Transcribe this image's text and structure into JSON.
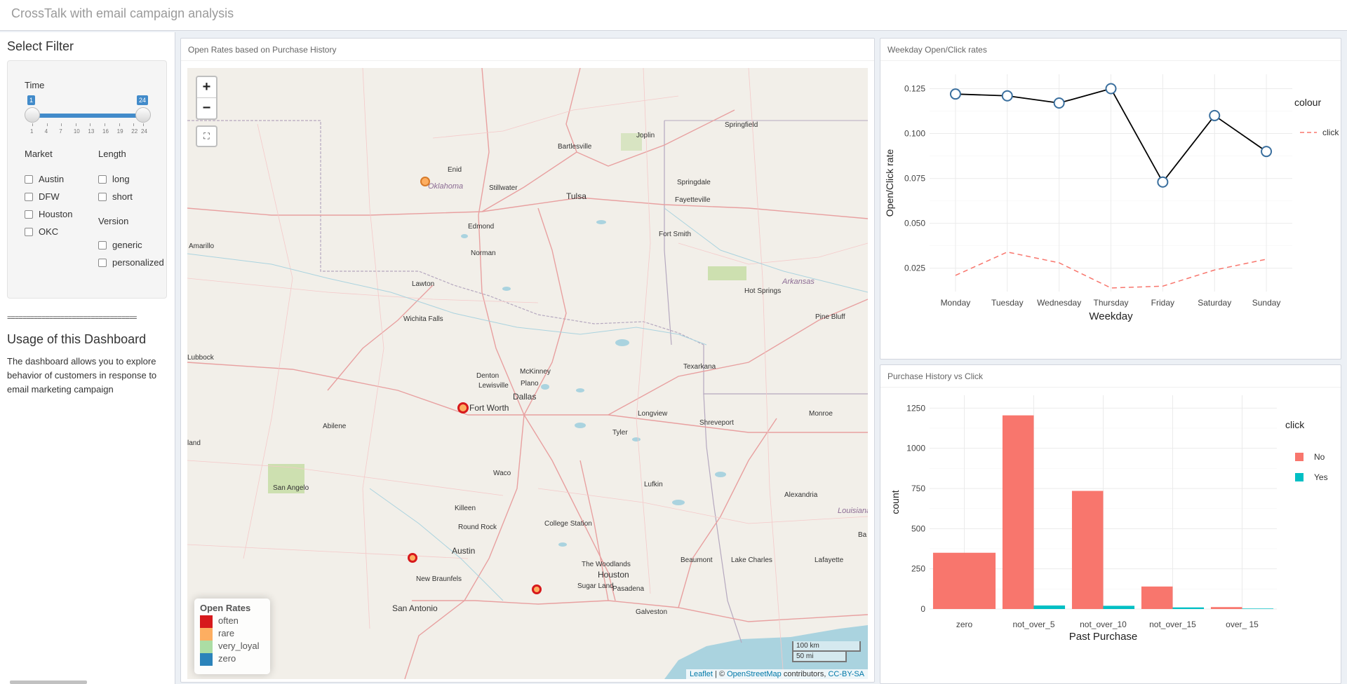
{
  "app": {
    "title": "CrossTalk with email campaign analysis"
  },
  "sidebar": {
    "filter_title": "Select Filter",
    "time": {
      "label": "Time",
      "min": 1,
      "max": 24,
      "min_badge": "1",
      "max_badge": "24",
      "ticks": [
        "1",
        "4",
        "7",
        "10",
        "13",
        "16",
        "19",
        "22",
        "24"
      ]
    },
    "market": {
      "label": "Market",
      "options": [
        "Austin",
        "DFW",
        "Houston",
        "OKC"
      ]
    },
    "length": {
      "label": "Length",
      "options": [
        "long",
        "short"
      ]
    },
    "version": {
      "label": "Version",
      "options": [
        "generic",
        "personalized"
      ]
    },
    "separator": "==================================",
    "usage_title": "Usage of this Dashboard",
    "usage_text": "The dashboard allows you to explore behavior of customers in response to email marketing campaign"
  },
  "map_panel": {
    "title": "Open Rates based on Purchase History",
    "zoom_in": "+",
    "zoom_out": "−",
    "fullscreen_icon": "fullscreen-icon",
    "legend": {
      "title": "Open Rates",
      "items": [
        {
          "label": "often",
          "color": "#d7191c"
        },
        {
          "label": "rare",
          "color": "#fdae61"
        },
        {
          "label": "very_loyal",
          "color": "#abdda4"
        },
        {
          "label": "zero",
          "color": "#2b83ba"
        }
      ]
    },
    "scale_km": "100 km",
    "scale_mi": "50 mi",
    "attribution": {
      "leaflet": "Leaflet",
      "sep": "| ©",
      "osm": "OpenStreetMap",
      "contrib": "contributors,",
      "license": "CC-BY-SA"
    },
    "cities": [
      "Springfield",
      "Joplin",
      "Bartlesville",
      "Enid",
      "Stillwater",
      "Tulsa",
      "Springdale",
      "Fayetteville",
      "Edmond",
      "Fort Smith",
      "Norman",
      "Amarillo",
      "Lawton",
      "Hot Springs",
      "Pine Bluff",
      "Wichita Falls",
      "Lubbock",
      "Denton",
      "McKinney",
      "Lewisville",
      "Plano",
      "Dallas",
      "Fort Worth",
      "Texarkana",
      "Longview",
      "Shreveport",
      "Monroe",
      "Abilene",
      "Tyler",
      "Waco",
      "Lufkin",
      "San Angelo",
      "Alexandria",
      "Killeen",
      "Round Rock",
      "College Station",
      "Austin",
      "The Woodlands",
      "Beaumont",
      "Lake Charles",
      "Lafayette",
      "New Braunfels",
      "Houston",
      "Sugar Land",
      "Pasadena",
      "San Antonio",
      "Galveston",
      "Ba",
      "land"
    ],
    "states": [
      "Oklahoma",
      "Arkansas",
      "Louisiana"
    ],
    "markers": [
      {
        "city": "Edmond",
        "category": "rare"
      },
      {
        "city": "Dallas",
        "category": "often"
      },
      {
        "city": "Austin",
        "category": "often"
      },
      {
        "city": "Houston",
        "category": "rare"
      }
    ]
  },
  "weekday_panel": {
    "title": "Weekday Open/Click rates",
    "chart_data": {
      "type": "line",
      "xlabel": "Weekday",
      "ylabel": "Open/Click rate",
      "categories": [
        "Monday",
        "Tuesday",
        "Wednesday",
        "Thursday",
        "Friday",
        "Saturday",
        "Sunday"
      ],
      "ylim": [
        0.012,
        0.133
      ],
      "yticks": [
        0.025,
        0.05,
        0.075,
        0.1,
        0.125
      ],
      "ytick_labels": [
        "0.025",
        "0.050",
        "0.075",
        "0.100",
        "0.125"
      ],
      "legend_title": "colour",
      "series": [
        {
          "values": [
            0.122,
            0.121,
            0.117,
            0.125,
            0.073,
            0.11,
            0.09
          ],
          "color": "#000000",
          "style": "solid-markers"
        },
        {
          "name": "click",
          "values": [
            0.021,
            0.034,
            0.028,
            0.014,
            0.015,
            0.024,
            0.03
          ],
          "color": "#f8766d",
          "style": "dashed"
        }
      ]
    }
  },
  "purchase_panel": {
    "title": "Purchase History vs Click",
    "chart_data": {
      "type": "bar",
      "xlabel": "Past Purchase",
      "ylabel": "count",
      "categories": [
        "zero",
        "not_over_5",
        "not_over_10",
        "not_over_15",
        "over_ 15"
      ],
      "ylim": [
        0,
        1330
      ],
      "yticks": [
        0,
        250,
        500,
        750,
        1000,
        1250
      ],
      "legend_title": "click",
      "series": [
        {
          "name": "No",
          "values": [
            350,
            1205,
            735,
            140,
            12
          ],
          "color": "#f8766d"
        },
        {
          "name": "Yes",
          "values": [
            0,
            22,
            20,
            10,
            3
          ],
          "color": "#00bfc4"
        }
      ]
    }
  }
}
